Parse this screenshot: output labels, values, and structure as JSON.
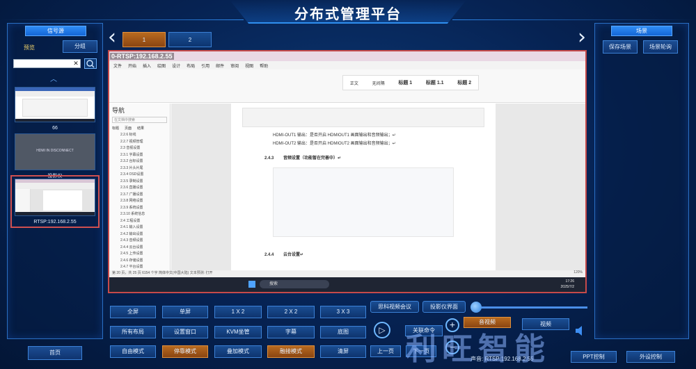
{
  "header": {
    "title": "分布式管理平台"
  },
  "left_panel": {
    "section_tag": "信号源",
    "preview_label": "预览",
    "group_button": "分组",
    "search": {
      "value": "",
      "placeholder": ""
    },
    "thumbnails": [
      {
        "label": "66"
      },
      {
        "label": "投影仪",
        "inner_text": "HDMI IN DISCONNECT"
      },
      {
        "label": "RTSP:192.168.2.55"
      }
    ],
    "home_button": "首页"
  },
  "right_panel": {
    "section_tag": "场景",
    "save_scene": "保存场景",
    "scene_tour": "场景轮询"
  },
  "pages": {
    "tabs": [
      "1",
      "2"
    ],
    "active": "1"
  },
  "screen": {
    "label": "0-RTSP:192.168.2.55",
    "word": {
      "tabs": [
        "文件",
        "开始",
        "插入",
        "绘图",
        "设计",
        "布局",
        "引用",
        "邮件",
        "审阅",
        "视图",
        "帮助"
      ],
      "nav_title": "导航",
      "nav_search_placeholder": "在文档中搜索",
      "nav_tabs": [
        "标题",
        "页面",
        "结果"
      ],
      "nav_items": [
        "2.2.6 标线",
        "2.2.7 视频管理",
        "2.3 音视设置",
        "2.3.1 字幕设置",
        "2.3.2 台标设置",
        "2.3.3 片头片尾",
        "2.3.4 OSD设置",
        "2.3.5 录制设置",
        "2.3.6 直播设置",
        "2.3.7 广播设置",
        "2.3.8 网络设置",
        "2.3.9 系统设置",
        "2.3.10 系统信息",
        "2.4 工程设置",
        "2.4.1 输入设置",
        "2.4.2 输出设置",
        "2.4.3 音频设置",
        "2.4.4 云台设置",
        "2.4.5 上传设置",
        "2.4.6 存储设置",
        "2.4.7 平台设置"
      ],
      "styles": [
        "正文",
        "无间隔",
        "标题 1",
        "标题 1.1",
        "标题 2"
      ],
      "doc_lines": [
        "HDMI-OUT1 输出：是否开启 HDMIOUT1 画面输出和音频输出；↵",
        "HDMI-OUT2 输出：是否开启 HDMIOUT2 画面输出和音频输出；↵"
      ],
      "heading_243": "2.4.3",
      "heading_243_text": "音频设置（功能暂在完善中）↵",
      "heading_244": "2.4.4",
      "heading_244_text": "云台设置↵",
      "status": "第 20 页，共 25 页   6154 个字   简体中文(中国大陆)   文本预测: 打开",
      "taskbar_search": "搜索",
      "clock_time": "17:26",
      "clock_date": "2025/7/2",
      "zoom": "120%"
    }
  },
  "controls": {
    "row1": [
      "全屏",
      "单屏",
      "1 X 2",
      "2 X 2",
      "3 X 3"
    ],
    "row2": [
      "所有布局",
      "设置窗口",
      "KVM坐管",
      "字幕",
      "底图"
    ],
    "row3": [
      "自由模式",
      "停靠模式",
      "叠加模式",
      "融接模式",
      "清屏"
    ],
    "meeting_button": "思科视频会议",
    "projector_screen": "投影仪界面",
    "related_commands": "关联命令",
    "prev_page": "上一页",
    "next_page": "下一页",
    "audio_video": "音视频",
    "video": "视频",
    "ppt_control": "PPT控制",
    "device_control": "外设控制",
    "status_text": "声音: RTSP:192.168.2.55",
    "watermark": "利旺智能"
  },
  "colors": {
    "accent": "#2f8cf5",
    "active_orange": "#b86a1f",
    "selection_red": "#c64a4a"
  }
}
